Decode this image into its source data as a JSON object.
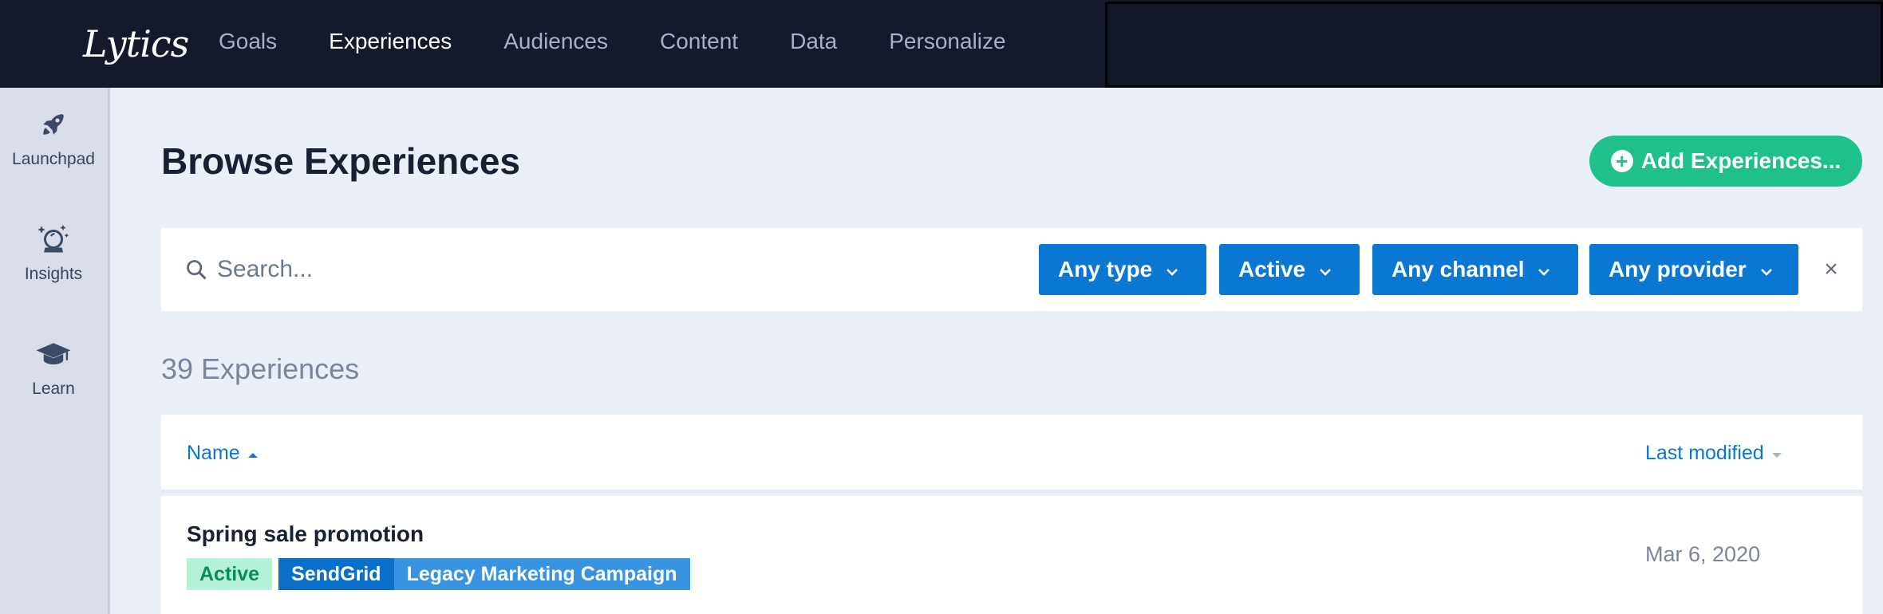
{
  "app": {
    "logo_text": "Lytics"
  },
  "nav": {
    "items": [
      {
        "label": "Goals",
        "active": false
      },
      {
        "label": "Experiences",
        "active": true
      },
      {
        "label": "Audiences",
        "active": false
      },
      {
        "label": "Content",
        "active": false
      },
      {
        "label": "Data",
        "active": false
      },
      {
        "label": "Personalize",
        "active": false
      }
    ]
  },
  "sidebar": {
    "items": [
      {
        "label": "Launchpad",
        "icon": "rocket-icon"
      },
      {
        "label": "Insights",
        "icon": "crystal-ball-icon"
      },
      {
        "label": "Learn",
        "icon": "graduation-cap-icon"
      }
    ]
  },
  "main": {
    "title": "Browse Experiences",
    "add_button_label": "Add Experiences...",
    "search": {
      "placeholder": "Search...",
      "value": ""
    },
    "filters": [
      {
        "label": "Any type"
      },
      {
        "label": "Active"
      },
      {
        "label": "Any channel"
      },
      {
        "label": "Any provider"
      }
    ],
    "clear_label": "×",
    "count_label": "39 Experiences",
    "table": {
      "columns": [
        {
          "label": "Name",
          "sort": "ascending"
        },
        {
          "label": "Last modified",
          "sort": "none"
        }
      ],
      "rows": [
        {
          "name": "Spring sale promotion",
          "status": "Active",
          "provider": "SendGrid",
          "type": "Legacy Marketing Campaign",
          "last_modified": "Mar 6, 2020"
        }
      ]
    }
  },
  "colors": {
    "topbar": "#141a2b",
    "accent_blue": "#0a78d2",
    "accent_green": "#1ec08c",
    "background": "#ebeff7"
  }
}
